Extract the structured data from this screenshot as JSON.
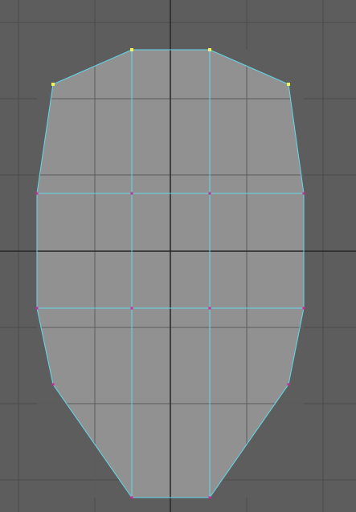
{
  "viewport": {
    "view": "orthographic-front",
    "background_color": "#5d5d5d",
    "grid": {
      "visible": true,
      "line_color": "#4a4a4a",
      "axis_color": "#262626"
    }
  },
  "mesh": {
    "object": "polygon-mesh",
    "mode": "vertex-selection",
    "face_color": "#919191",
    "wire_color": "#62d8ec",
    "unselected_vertex_color": "#c8289c",
    "selected_vertex_color": "#f4f25a",
    "vertex_count": 16,
    "selected_vertex_count": 4,
    "face_count": 9
  }
}
